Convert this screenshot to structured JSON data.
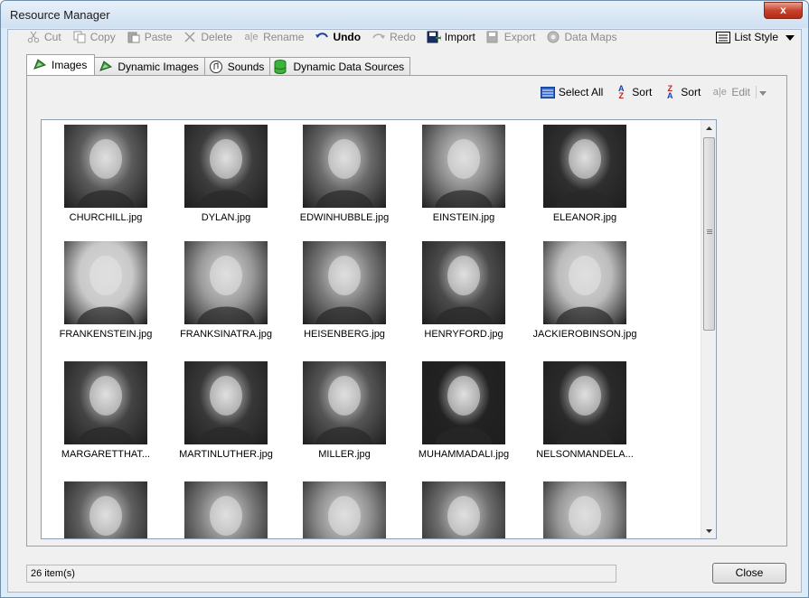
{
  "window": {
    "title": "Resource Manager",
    "close_glyph": "x"
  },
  "toolbar": {
    "cut": "Cut",
    "copy": "Copy",
    "paste": "Paste",
    "delete": "Delete",
    "rename": "Rename",
    "undo": "Undo",
    "redo": "Redo",
    "import": "Import",
    "export": "Export",
    "data_maps": "Data Maps",
    "list_style": "List Style"
  },
  "tabs": [
    {
      "label": "Images",
      "icon": "images-icon",
      "active": true
    },
    {
      "label": "Dynamic Images",
      "icon": "dynamic-images-icon",
      "active": false
    },
    {
      "label": "Sounds",
      "icon": "sounds-icon",
      "active": false
    },
    {
      "label": "Dynamic Data Sources",
      "icon": "database-icon",
      "active": false
    }
  ],
  "subtoolbar": {
    "select_all": "Select All",
    "sort_asc": "Sort",
    "sort_desc": "Sort",
    "edit": "Edit"
  },
  "images": [
    {
      "name": "CHURCHILL.jpg",
      "tone": "#5b5b5b"
    },
    {
      "name": "DYLAN.jpg",
      "tone": "#3d3d3d"
    },
    {
      "name": "EDWINHUBBLE.jpg",
      "tone": "#6a6a6a"
    },
    {
      "name": "EINSTEIN.jpg",
      "tone": "#8a8a8a"
    },
    {
      "name": "ELEANOR.jpg",
      "tone": "#2f2f2f"
    },
    {
      "name": "FRANKENSTEIN.jpg",
      "tone": "#c9c9c9"
    },
    {
      "name": "FRANKSINATRA.jpg",
      "tone": "#9a9a9a"
    },
    {
      "name": "HEISENBERG.jpg",
      "tone": "#7a7a7a"
    },
    {
      "name": "HENRYFORD.jpg",
      "tone": "#4b4b4b"
    },
    {
      "name": "JACKIEROBINSON.jpg",
      "tone": "#bcbcbc"
    },
    {
      "name": "MARGARETTHAT...",
      "tone": "#444444"
    },
    {
      "name": "MARTINLUTHER.jpg",
      "tone": "#383838"
    },
    {
      "name": "MILLER.jpg",
      "tone": "#555555"
    },
    {
      "name": "MUHAMMADALI.jpg",
      "tone": "#222222"
    },
    {
      "name": "NELSONMANDELA...",
      "tone": "#2a2a2a"
    },
    {
      "name": "",
      "tone": "#5f5f5f"
    },
    {
      "name": "",
      "tone": "#7c7c7c"
    },
    {
      "name": "",
      "tone": "#8f8f8f"
    },
    {
      "name": "",
      "tone": "#6d6d6d"
    },
    {
      "name": "",
      "tone": "#9a9a9a"
    }
  ],
  "status": {
    "count": "26 item(s)"
  },
  "buttons": {
    "close": "Close"
  }
}
